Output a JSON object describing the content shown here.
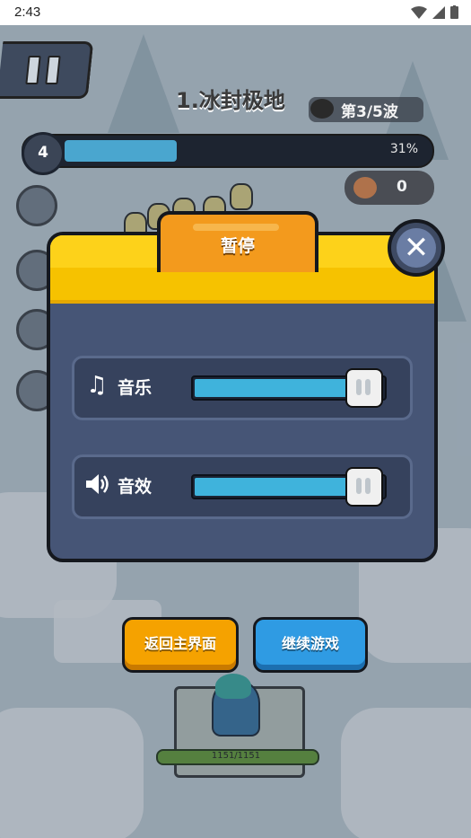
{
  "status_bar": {
    "time": "2:43"
  },
  "hud": {
    "level_title": "1.冰封极地",
    "wave": "第3/5波",
    "wave_number": "4",
    "progress_percent": "31%",
    "progress_fraction": 0.31,
    "meat_count": "0",
    "hero_hp": "1151/1151"
  },
  "pause_dialog": {
    "title": "暂停",
    "close_icon": "close-icon",
    "music_label": "音乐",
    "music_icon": "music-note-icon",
    "music_volume": 1.0,
    "sfx_label": "音效",
    "sfx_icon": "speaker-icon",
    "sfx_volume": 1.0
  },
  "buttons": {
    "home_label": "返回主界面",
    "continue_label": "继续游戏"
  },
  "colors": {
    "header_yellow": "#f6c200",
    "tab_orange": "#f39a1d",
    "panel_blue": "#465576",
    "slider_fill": "#3fb3dc",
    "home_button": "#f5a200",
    "continue_button": "#2f9be3"
  }
}
